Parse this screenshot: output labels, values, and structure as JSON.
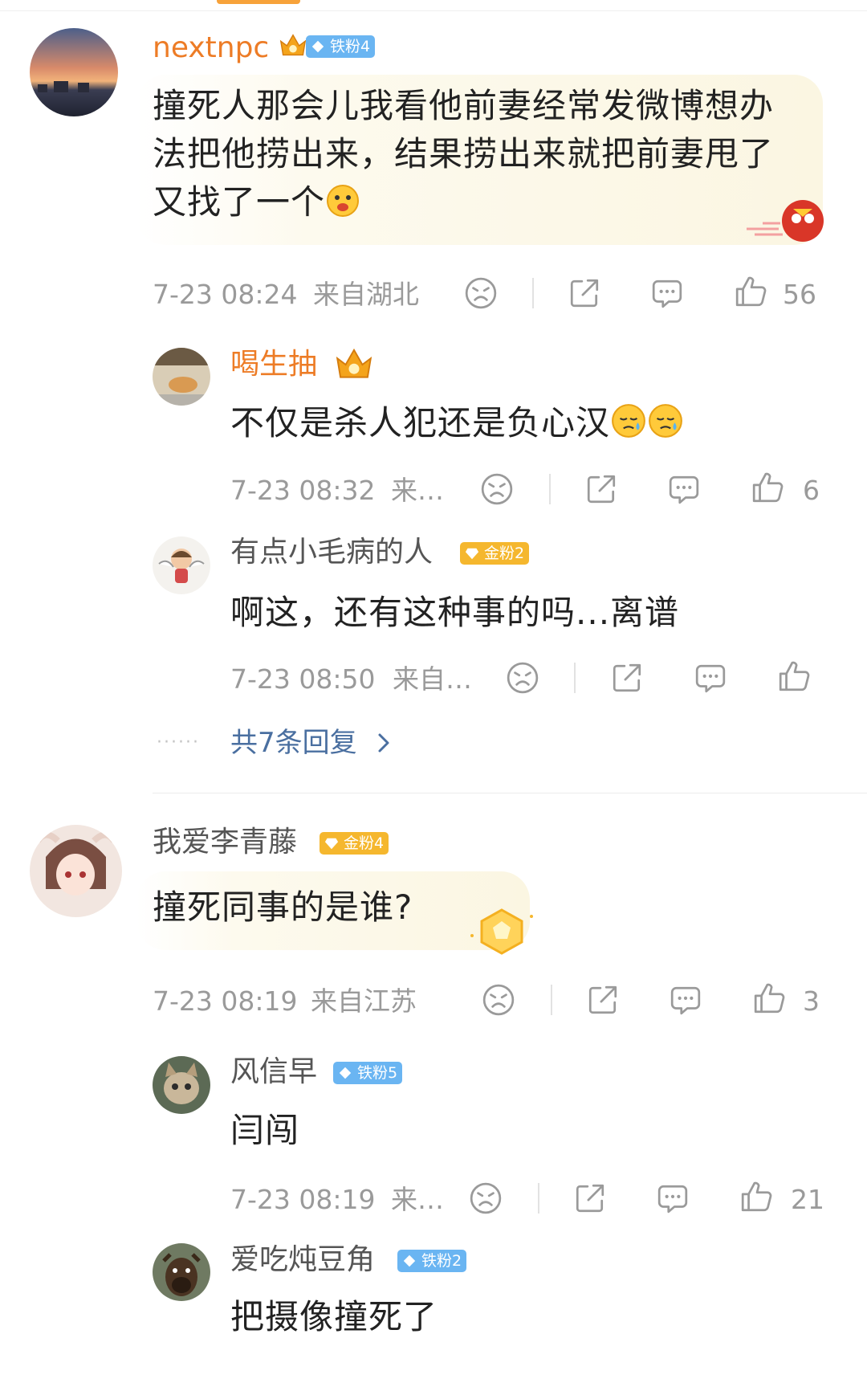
{
  "comments": [
    {
      "username": "nextnpc",
      "badge": "铁粉4",
      "text": "撞死人那会儿我看他前妻经常发微博想办法把他捞出来，结果捞出来就把前妻甩了又找了一个",
      "time": "7-23 08:24",
      "location": "来自湖北",
      "likes": "56"
    },
    {
      "username": "喝生抽",
      "text": "不仅是杀人犯还是负心汉",
      "time": "7-23 08:32",
      "location": "来…",
      "likes": "6"
    },
    {
      "username": "有点小毛病的人",
      "badge": "金粉2",
      "text": "啊这，还有这种事的吗...离谱",
      "time": "7-23 08:50",
      "location": "来自…",
      "likes": ""
    },
    {
      "username": "我爱李青藤",
      "badge": "金粉4",
      "text": "撞死同事的是谁?",
      "time": "7-23 08:19",
      "location": "来自江苏",
      "likes": "3"
    },
    {
      "username": "风信早",
      "badge": "铁粉5",
      "text": "闫闯",
      "time": "7-23 08:19",
      "location": "来…",
      "likes": "21"
    },
    {
      "username": "爱吃炖豆角",
      "badge": "铁粉2",
      "text": "把摄像撞死了"
    }
  ],
  "more_replies": "共7条回复",
  "more_replies_dots": "······",
  "colors": {
    "username_vip": "#ed7c26",
    "link": "#4a6fa0",
    "iron_badge": "#6ab5f2",
    "gold_badge": "#f5b72e",
    "meta_gray": "#9a9a9a"
  },
  "icons": [
    "dislike-icon",
    "share-icon",
    "comment-icon",
    "like-icon",
    "chevron-right-icon",
    "crown-icon"
  ]
}
